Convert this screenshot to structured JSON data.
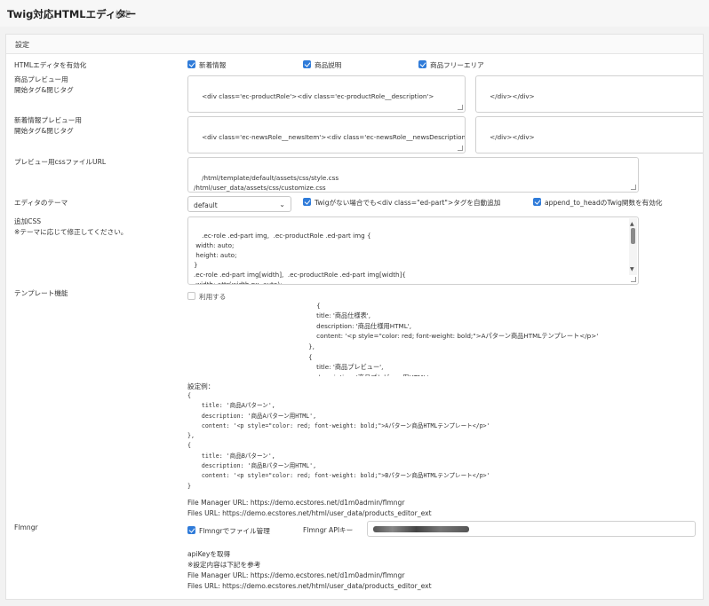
{
  "header": {
    "title": "Twig対応HTMLエディター",
    "subtitle": "設定"
  },
  "card": {
    "heading": "設定"
  },
  "enable": {
    "label": "HTMLエディタを有効化",
    "options": [
      {
        "label": "新着情報",
        "checked": true
      },
      {
        "label": "商品説明",
        "checked": true
      },
      {
        "label": "商品フリーエリア",
        "checked": true
      }
    ]
  },
  "product_preview": {
    "label_line1": "商品プレビュー用",
    "label_line2": "開始タグ&閉じタグ",
    "open_tag": "<div class='ec-productRole'><div class='ec-productRole__description'>",
    "close_tag": "</div></div>"
  },
  "news_preview": {
    "label_line1": "新着情報プレビュー用",
    "label_line2": "開始タグ&閉じタグ",
    "open_tag": "<div class='ec-newsRole__newsItem'><div class='ec-newsRole__newsDescription'>",
    "close_tag": "</div></div>"
  },
  "css_url": {
    "label": "プレビュー用cssファイルURL",
    "value": "/html/template/default/assets/css/style.css\n/html/user_data/assets/css/customize.css"
  },
  "theme": {
    "label": "エディタのテーマ",
    "selected": "default",
    "auto_div": {
      "label": "Twigがない場合でも<div class=\"ed-part\">タグを自動追加",
      "checked": true
    },
    "append_head": {
      "label": "append_to_headのTwig関数を有効化",
      "checked": true
    }
  },
  "extra_css": {
    "label_line1": "追加CSS",
    "label_line2": "※テーマに応じて修正してください。",
    "value": ".ec-role .ed-part img,  .ec-productRole .ed-part img {\n width: auto;\n height: auto;\n}\n.ec-role .ed-part img[width],  .ec-productRole .ed-part img[width]{\n width: attr(width px, auto);"
  },
  "template": {
    "label": "テンプレート機能",
    "use_label": "利用する",
    "use_checked": false,
    "value": "{\n    title: '商品仕様表',\n    description: '商品仕様用HTML',\n    content: '<p style=\"color: red; font-weight: bold;\">Aパターン商品HTMLテンプレート</p>'\n},\n{\n    title: '商品プレビュー',\n    description: '商品プレビュー用HTML',\n    content: '<p style=\"color: red; font-weight: bold;\">Bパターン商品HTMLテンプレート</p>'",
    "example_heading": "設定例：",
    "example_code": "{\n    title: '商品Aパターン',\n    description: '商品Aパターン用HTML',\n    content: '<p style=\"color: red; font-weight: bold;\">Aパターン商品HTMLテンプレート</p>'\n},\n{\n    title: '商品Bパターン',\n    description: '商品Bパターン用HTML',\n    content: '<p style=\"color: red; font-weight: bold;\">Bパターン商品HTMLテンプレート</p>'\n}",
    "file_manager_url": "File Manager URL: https://demo.ecstores.net/d1m0admin/flmngr",
    "files_url": "Files URL: https://demo.ecstores.net/html/user_data/products_editor_ext"
  },
  "flmngr": {
    "label": "Flmngr",
    "use_label": "Flmngrでファイル管理",
    "use_checked": true,
    "api_key_label": "Flmngr APIキー",
    "api_link": "apiKeyを取得",
    "note": "※設定内容は下記を参考",
    "file_manager_url": "File Manager URL: https://demo.ecstores.net/d1m0admin/flmngr",
    "files_url": "Files URL: https://demo.ecstores.net/html/user_data/products_editor_ext"
  },
  "colors": {
    "accent": "#2f7bd9",
    "border": "#d0d0d0",
    "page_bg": "#f2f2f2"
  }
}
